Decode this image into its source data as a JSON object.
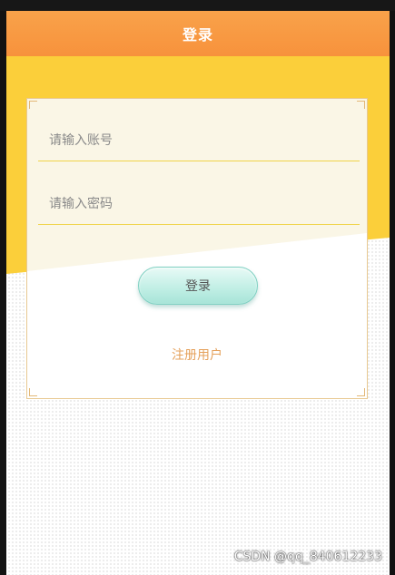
{
  "header": {
    "title": "登录"
  },
  "form": {
    "account_placeholder": "请输入账号",
    "password_placeholder": "请输入密码",
    "login_label": "登录",
    "register_label": "注册用户"
  },
  "watermark": "CSDN @qq_840612233",
  "colors": {
    "header": "#f7923c",
    "band": "#fbcf3a",
    "card_border": "#e8c992",
    "field_line": "#f0d44a",
    "button": "#bfeee4",
    "register_link": "#e5a15b"
  }
}
